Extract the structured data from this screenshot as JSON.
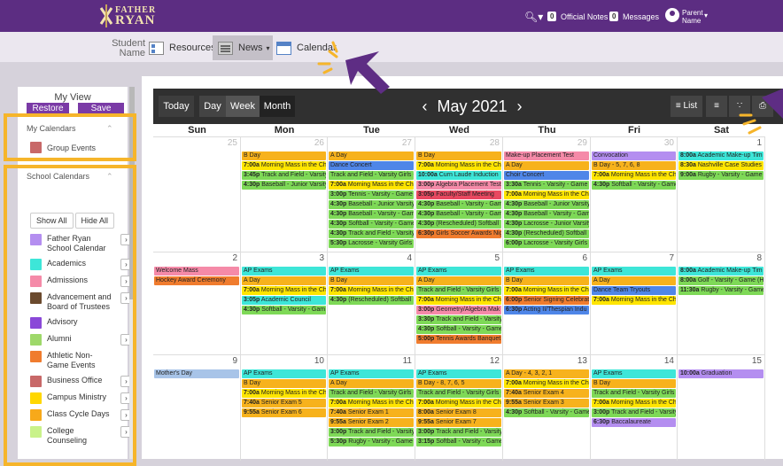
{
  "topbar": {
    "logo_line1": "FATHER",
    "logo_line2": "RYAN",
    "official_notes_count": "0",
    "official_notes_label": "Official Notes",
    "messages_count": "0",
    "messages_label": "Messages",
    "user_line1": "Parent",
    "user_line2": "Name"
  },
  "subnav": {
    "student_line1": "Student",
    "student_line2": "Name",
    "resources": "Resources",
    "news": "News",
    "calendar": "Calendar"
  },
  "sidebar": {
    "view_title": "My View",
    "restore": "Restore",
    "save": "Save",
    "my_calendars": "My Calendars",
    "group_events": "Group Events",
    "school_calendars": "School Calendars",
    "show_all": "Show All",
    "hide_all": "Hide All",
    "calendars": [
      {
        "label": "Father Ryan School Calendar",
        "color": "#b48ef0",
        "arrow": true
      },
      {
        "label": "Academics",
        "color": "#3de6d8",
        "arrow": true
      },
      {
        "label": "Admissions",
        "color": "#f58aa8",
        "arrow": true
      },
      {
        "label": "Advancement and Board of Trustees",
        "color": "#6b4a2e",
        "arrow": true
      },
      {
        "label": "Advisory",
        "color": "#8a48d8",
        "arrow": false
      },
      {
        "label": "Alumni",
        "color": "#9ed86a",
        "arrow": true
      },
      {
        "label": "Athletic Non-Game Events",
        "color": "#f07c2e",
        "arrow": false
      },
      {
        "label": "Business Office",
        "color": "#c86868",
        "arrow": true
      },
      {
        "label": "Campus Ministry",
        "color": "#ffd700",
        "arrow": true
      },
      {
        "label": "Class Cycle Days",
        "color": "#f7a91a",
        "arrow": true
      },
      {
        "label": "College Counseling",
        "color": "#c9f28a",
        "arrow": true
      }
    ]
  },
  "toolbar": {
    "today": "Today",
    "day": "Day",
    "week": "Week",
    "month": "Month",
    "title": "May 2021",
    "list": "List"
  },
  "days": [
    "Sun",
    "Mon",
    "Tue",
    "Wed",
    "Thu",
    "Fri",
    "Sat"
  ],
  "weeks": [
    {
      "nums": [
        "25",
        "26",
        "27",
        "28",
        "29",
        "30",
        "1"
      ],
      "dim": [
        true,
        true,
        true,
        true,
        true,
        true,
        false
      ],
      "events": [
        [],
        [
          [
            "",
            "B Day",
            "#f7b21c"
          ],
          [
            "7:00a",
            "Morning Mass in the Ch",
            "#ffe500"
          ],
          [
            "3:45p",
            "Track and Field - Varsity",
            "#7ed957"
          ],
          [
            "4:30p",
            "Baseball - Junior Varsity",
            "#7ed957"
          ]
        ],
        [
          [
            "",
            "A Day",
            "#f7b21c"
          ],
          [
            "",
            "Dance Concert",
            "#4f86e8"
          ],
          [
            "",
            "Track and Field - Varsity Girls -",
            "#7ed957"
          ],
          [
            "7:00a",
            "Morning Mass in the Ch",
            "#ffe500"
          ],
          [
            "3:00p",
            "Tennis - Varsity - Game",
            "#7ed957"
          ],
          [
            "4:30p",
            "Baseball - Junior Varsity",
            "#7ed957"
          ],
          [
            "4:30p",
            "Baseball - Varsity - Gam",
            "#7ed957"
          ],
          [
            "4:30p",
            "Softball - Varsity - Game",
            "#7ed957"
          ],
          [
            "4:30p",
            "Track and Field - Varsity",
            "#7ed957"
          ],
          [
            "5:30p",
            "Lacrosse - Varsity Girls",
            "#7ed957"
          ]
        ],
        [
          [
            "",
            "B Day",
            "#f7b21c"
          ],
          [
            "7:00a",
            "Morning Mass in the Ch",
            "#ffe500"
          ],
          [
            "10:00a",
            "Curn Laude Induction",
            "#3de6d8"
          ],
          [
            "3:00p",
            "Algebra Placement Test",
            "#f58aa8"
          ],
          [
            "3:05p",
            "Faculty/Staff Meeting",
            "#e84860"
          ],
          [
            "4:30p",
            "Baseball - Varsity - Gam",
            "#7ed957"
          ],
          [
            "4:30p",
            "Baseball - Varsity - Gam",
            "#7ed957"
          ],
          [
            "4:30p",
            "(Rescheduled) Softball",
            "#7ed957"
          ],
          [
            "6:30p",
            "Girls Soccer Awards Nig",
            "#f07c2e"
          ]
        ],
        [
          [
            "",
            "Make-up Placement Test",
            "#f58aa8"
          ],
          [
            "",
            "A Day",
            "#f7b21c"
          ],
          [
            "",
            "Choir Concert",
            "#4f86e8"
          ],
          [
            "3:30a",
            "Tennis - Varsity - Game",
            "#7ed957"
          ],
          [
            "7:00a",
            "Morning Mass in the Ch",
            "#ffe500"
          ],
          [
            "4:30p",
            "Baseball - Junior Varsity",
            "#7ed957"
          ],
          [
            "4:30p",
            "Baseball - Varsity - Gam",
            "#7ed957"
          ],
          [
            "4:30p",
            "Lacrosse - Junior Varsity",
            "#7ed957"
          ],
          [
            "4:30p",
            "(Rescheduled) Softball",
            "#7ed957"
          ],
          [
            "6:00p",
            "Lacrosse - Varsity Girls",
            "#7ed957"
          ]
        ],
        [
          [
            "",
            "Convocation",
            "#b48ef0"
          ],
          [
            "",
            "B Day - 5, 7, 6, 8",
            "#f7b21c"
          ],
          [
            "7:00a",
            "Morning Mass in the Ch",
            "#ffe500"
          ],
          [
            "4:30p",
            "Softball - Varsity - Game",
            "#7ed957"
          ]
        ],
        [
          [
            "8:00a",
            "Academic Make-up Tim",
            "#3de6d8"
          ],
          [
            "8:30a",
            "Nashville Case Studies I",
            "#ffe500"
          ],
          [
            "9:00a",
            "Rugby - Varsity - Game",
            "#7ed957"
          ]
        ]
      ]
    },
    {
      "nums": [
        "2",
        "3",
        "4",
        "5",
        "6",
        "7",
        "8"
      ],
      "dim": [
        false,
        false,
        false,
        false,
        false,
        false,
        false
      ],
      "events": [
        [
          [
            "",
            "Welcome Mass",
            "#f58aa8"
          ],
          [
            "",
            "Hockey Award Ceremony",
            "#f07c2e"
          ]
        ],
        [
          [
            "",
            "AP Exams",
            "#3de6d8"
          ],
          [
            "",
            "A Day",
            "#f7b21c"
          ],
          [
            "7:00a",
            "Morning Mass in the Ch",
            "#ffe500"
          ],
          [
            "3:05p",
            "Academic Council",
            "#3de6d8"
          ],
          [
            "4:30p",
            "Softball - Varsity - Gam",
            "#7ed957"
          ]
        ],
        [
          [
            "",
            "AP Exams",
            "#3de6d8"
          ],
          [
            "",
            "B Day",
            "#f7b21c"
          ],
          [
            "7:00a",
            "Morning Mass in the Ch",
            "#ffe500"
          ],
          [
            "4:30p",
            "(Rescheduled) Softball",
            "#7ed957"
          ]
        ],
        [
          [
            "",
            "AP Exams",
            "#3de6d8"
          ],
          [
            "",
            "A Day",
            "#f7b21c"
          ],
          [
            "",
            "Track and Field - Varsity Girls -",
            "#7ed957"
          ],
          [
            "7:00a",
            "Morning Mass in the Ch",
            "#ffe500"
          ],
          [
            "3:00p",
            "Geometry/Algebra Mak",
            "#f58aa8"
          ],
          [
            "3:30p",
            "Track and Field - Varsity",
            "#7ed957"
          ],
          [
            "4:30p",
            "Softball - Varsity - Game",
            "#7ed957"
          ],
          [
            "5:00p",
            "Tennis Awards Banquet",
            "#f07c2e"
          ]
        ],
        [
          [
            "",
            "AP Exams",
            "#3de6d8"
          ],
          [
            "",
            "B Day",
            "#f7b21c"
          ],
          [
            "7:00a",
            "Morning Mass in the Ch",
            "#ffe500"
          ],
          [
            "6:00p",
            "Senior Signing Celebrat",
            "#f07c2e"
          ],
          [
            "6:30p",
            "Acting II/Thespian Indu",
            "#4f86e8"
          ]
        ],
        [
          [
            "",
            "AP Exams",
            "#3de6d8"
          ],
          [
            "",
            "A Day",
            "#f7b21c"
          ],
          [
            "",
            "Dance Team Tryouts",
            "#4f86e8"
          ],
          [
            "7:00a",
            "Morning Mass in the Ch",
            "#ffe500"
          ]
        ],
        [
          [
            "8:00a",
            "Academic Make-up Tim",
            "#3de6d8"
          ],
          [
            "8:00a",
            "Golf - Varsity - Game (H",
            "#7ed957"
          ],
          [
            "11:30a",
            "Rugby - Varsity - Game",
            "#7ed957"
          ]
        ]
      ]
    },
    {
      "nums": [
        "9",
        "10",
        "11",
        "12",
        "13",
        "14",
        "15"
      ],
      "dim": [
        false,
        false,
        false,
        false,
        false,
        false,
        false
      ],
      "events": [
        [
          [
            "",
            "Mother's Day",
            "#a8c4e8"
          ]
        ],
        [
          [
            "",
            "AP Exams",
            "#3de6d8"
          ],
          [
            "",
            "B Day",
            "#f7b21c"
          ],
          [
            "7:00a",
            "Morning Mass in the Ch",
            "#ffe500"
          ],
          [
            "7:40a",
            "Senior Exam 5",
            "#f7b21c"
          ],
          [
            "9:55a",
            "Senior Exam 6",
            "#f7b21c"
          ]
        ],
        [
          [
            "",
            "AP Exams",
            "#3de6d8"
          ],
          [
            "",
            "A Day",
            "#f7b21c"
          ],
          [
            "",
            "Track and Field - Varsity Girls -",
            "#7ed957"
          ],
          [
            "7:00a",
            "Morning Mass in the Ch",
            "#ffe500"
          ],
          [
            "7:40a",
            "Senior Exam 1",
            "#f7b21c"
          ],
          [
            "9:55a",
            "Senior Exam 2",
            "#f7b21c"
          ],
          [
            "3:00p",
            "Track and Field - Varsity",
            "#7ed957"
          ],
          [
            "5:30p",
            "Rugby - Varsity - Game",
            "#7ed957"
          ]
        ],
        [
          [
            "",
            "AP Exams",
            "#3de6d8"
          ],
          [
            "",
            "B Day - 8, 7, 6, 5",
            "#f7b21c"
          ],
          [
            "",
            "Track and Field - Varsity Girls -",
            "#7ed957"
          ],
          [
            "7:00a",
            "Morning Mass in the Ch",
            "#ffe500"
          ],
          [
            "8:00a",
            "Senior Exam 8",
            "#f7b21c"
          ],
          [
            "9:55a",
            "Senior Exam 7",
            "#f7b21c"
          ],
          [
            "3:00p",
            "Track and Field - Varsity",
            "#7ed957"
          ],
          [
            "3:15p",
            "Softball - Varsity - Game",
            "#7ed957"
          ]
        ],
        [
          [
            "",
            "A Day - 4, 3, 2, 1",
            "#f7b21c"
          ],
          [
            "7:00a",
            "Morning Mass in the Ch",
            "#ffe500"
          ],
          [
            "7:40a",
            "Senior Exam 4",
            "#f7b21c"
          ],
          [
            "9:55a",
            "Senior Exam 3",
            "#f7b21c"
          ],
          [
            "4:30p",
            "Softball - Varsity - Game",
            "#7ed957"
          ]
        ],
        [
          [
            "",
            "AP Exams",
            "#3de6d8"
          ],
          [
            "",
            "B Day",
            "#f7b21c"
          ],
          [
            "",
            "Track and Field - Varsity Girls -",
            "#7ed957"
          ],
          [
            "7:00a",
            "Morning Mass in the Ch",
            "#ffe500"
          ],
          [
            "3:00p",
            "Track and Field - Varsity",
            "#7ed957"
          ],
          [
            "6:30p",
            "Baccalaureate",
            "#b48ef0"
          ]
        ],
        [
          [
            "10:00a",
            "Graduation",
            "#b48ef0"
          ]
        ]
      ]
    }
  ],
  "colors": {
    "brand": "#5c2d82",
    "highlight": "#f6b52a",
    "arrow": "#5e2d84"
  }
}
